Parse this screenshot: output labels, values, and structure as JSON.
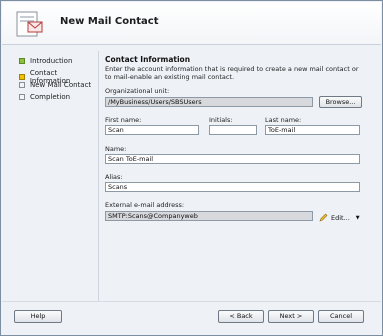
{
  "window": {
    "title": "New Mail Contact"
  },
  "steps": [
    {
      "label": "Introduction",
      "state": "done"
    },
    {
      "label": "Contact Information",
      "state": "current"
    },
    {
      "label": "New Mail Contact",
      "state": "pending"
    },
    {
      "label": "Completion",
      "state": "pending"
    }
  ],
  "section": {
    "title": "Contact Information",
    "description": "Enter the account information that is required to create a new mail contact or to mail-enable an existing mail contact."
  },
  "org_unit": {
    "label": "Organizational unit:",
    "value": "/MyBusiness/Users/SBSUsers",
    "browse_label": "Browse..."
  },
  "first_name": {
    "label": "First name:",
    "value": "Scan"
  },
  "initials": {
    "label": "Initials:",
    "value": ""
  },
  "last_name": {
    "label": "Last name:",
    "value": "ToE-mail"
  },
  "name": {
    "label": "Name:",
    "value": "Scan ToE-mail"
  },
  "alias": {
    "label": "Alias:",
    "value": "Scans"
  },
  "external_email": {
    "label": "External e-mail address:",
    "value": "SMTP:Scans@Companyweb",
    "edit_label": "Edit..."
  },
  "footer": {
    "help": "Help",
    "back": "< Back",
    "next": "Next >",
    "cancel": "Cancel"
  },
  "colors": {
    "step_done": "#8fbf3f",
    "step_current": "#f0c200",
    "window_bg": "#eef2f6"
  }
}
